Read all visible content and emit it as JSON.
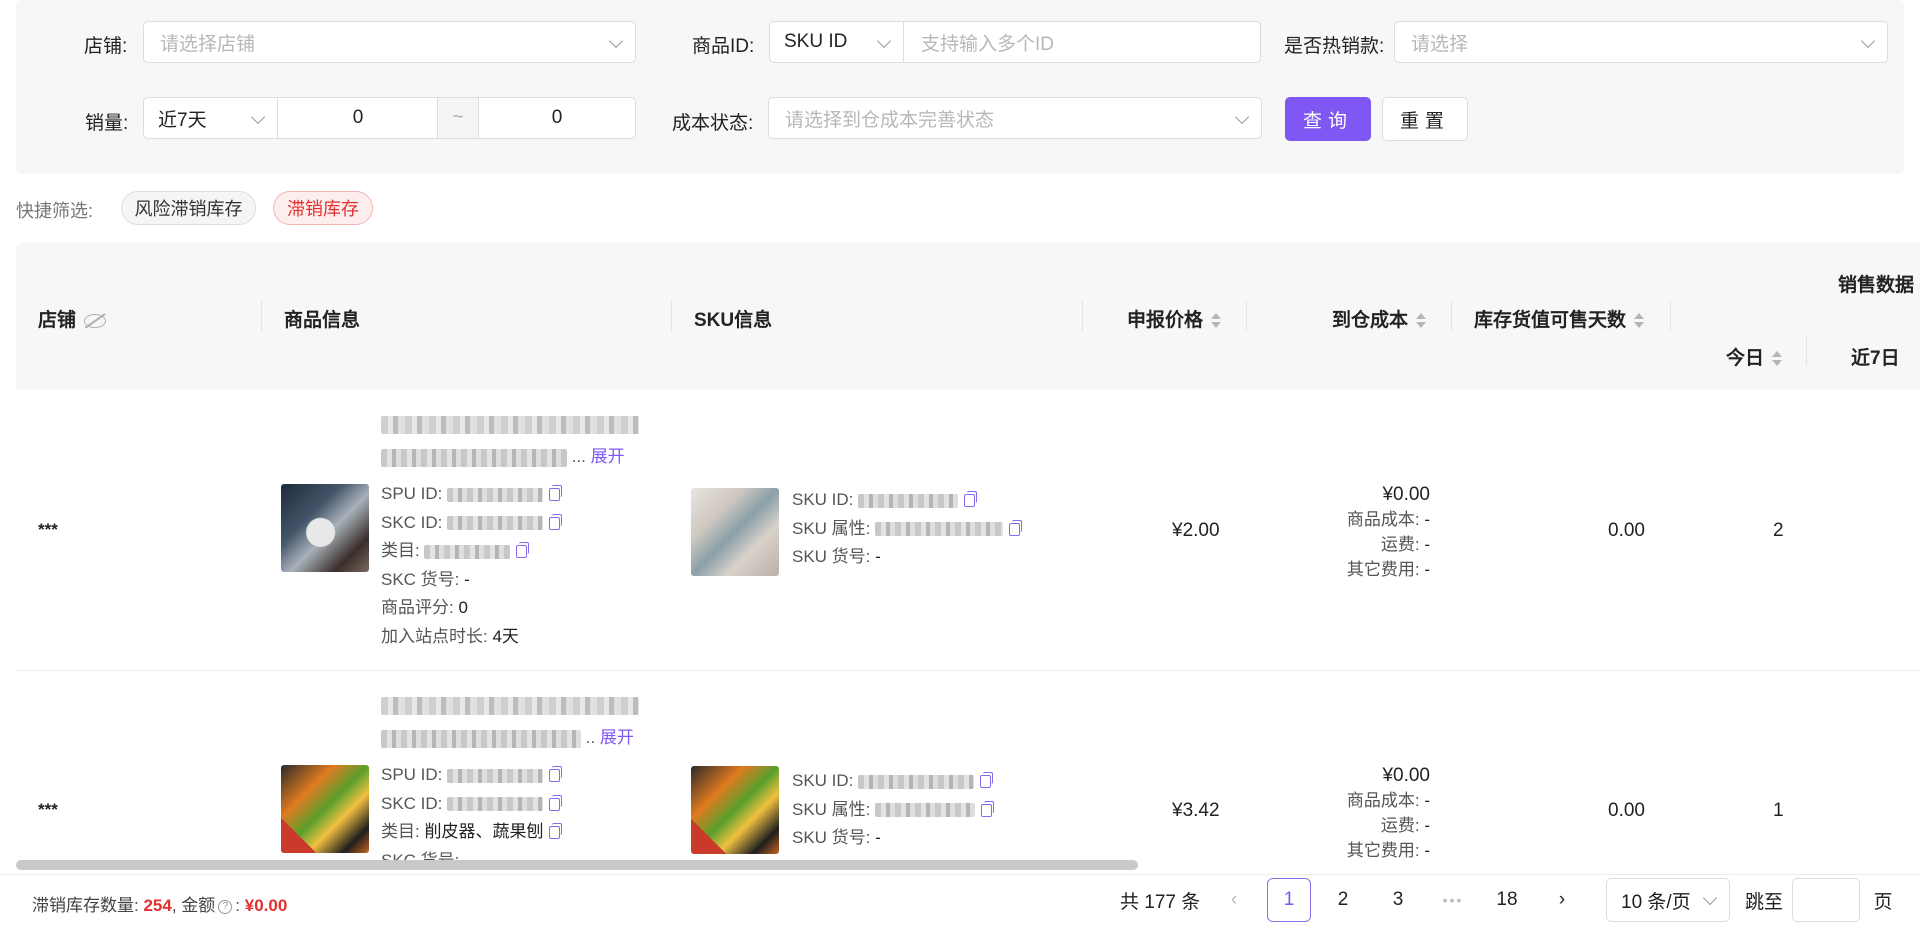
{
  "filters": {
    "shop": {
      "label": "店铺:",
      "placeholder": "请选择店铺"
    },
    "product_id": {
      "label": "商品ID:",
      "type_value": "SKU ID",
      "placeholder": "支持输入多个ID"
    },
    "hot": {
      "label": "是否热销款:",
      "placeholder": "请选择"
    },
    "sales": {
      "label": "销量:",
      "period": "近7天",
      "min": "0",
      "sep": "~",
      "max": "0"
    },
    "cost_status": {
      "label": "成本状态:",
      "placeholder": "请选择到仓成本完善状态"
    },
    "query_label": "查询",
    "reset_label": "重置"
  },
  "quick_filter": {
    "label": "快捷筛选:",
    "chips": [
      "风险滞销库存",
      "滞销库存"
    ]
  },
  "table": {
    "headers": {
      "shop": "店铺",
      "product": "商品信息",
      "sku": "SKU信息",
      "price": "申报价格",
      "cost": "到仓成本",
      "days": "库存货值可售天数",
      "sales_group": "销售数据",
      "today": "今日",
      "week": "近7日"
    },
    "rows": [
      {
        "shop": "***",
        "expand": "展开",
        "spu_label": "SPU ID:",
        "skc_label": "SKC ID:",
        "category_label": "类目:",
        "category": "",
        "skc_no_label": "SKC 货号:",
        "skc_no": "-",
        "rating_label": "商品评分:",
        "rating": "0",
        "joined_label": "加入站点时长:",
        "joined": "4天",
        "sku_id_label": "SKU ID:",
        "sku_attr_label": "SKU 属性:",
        "sku_no_label": "SKU 货号:",
        "sku_no": "-",
        "price": "¥2.00",
        "cost_total": "¥0.00",
        "cost_goods_label": "商品成本:",
        "cost_goods": "-",
        "freight_label": "运费:",
        "freight": "-",
        "other_label": "其它费用:",
        "other": "-",
        "days": "0.00",
        "today": "2"
      },
      {
        "shop": "***",
        "expand": "展开",
        "spu_label": "SPU ID:",
        "skc_label": "SKC ID:",
        "category_label": "类目:",
        "category": "削皮器、蔬果刨",
        "skc_no_label": "SKC 货号:",
        "skc_no": "-",
        "sku_id_label": "SKU ID:",
        "sku_attr_label": "SKU 属性:",
        "sku_no_label": "SKU 货号:",
        "sku_no": "-",
        "price": "¥3.42",
        "cost_total": "¥0.00",
        "cost_goods_label": "商品成本:",
        "cost_goods": "-",
        "freight_label": "运费:",
        "freight": "-",
        "other_label": "其它费用:",
        "other": "-",
        "days": "0.00",
        "today": "1"
      }
    ]
  },
  "footer": {
    "stock_label": "滞销库存数量:",
    "stock_count": "254",
    "amount_label": "金额",
    "amount_value": "¥0.00",
    "total": "共 177 条",
    "pages": [
      "1",
      "2",
      "3",
      "•••",
      "18"
    ],
    "page_size": "10 条/页",
    "jump_label": "跳至",
    "page_unit": "页"
  },
  "colors": {
    "accent": "#7f57f2",
    "danger": "#e23030"
  }
}
